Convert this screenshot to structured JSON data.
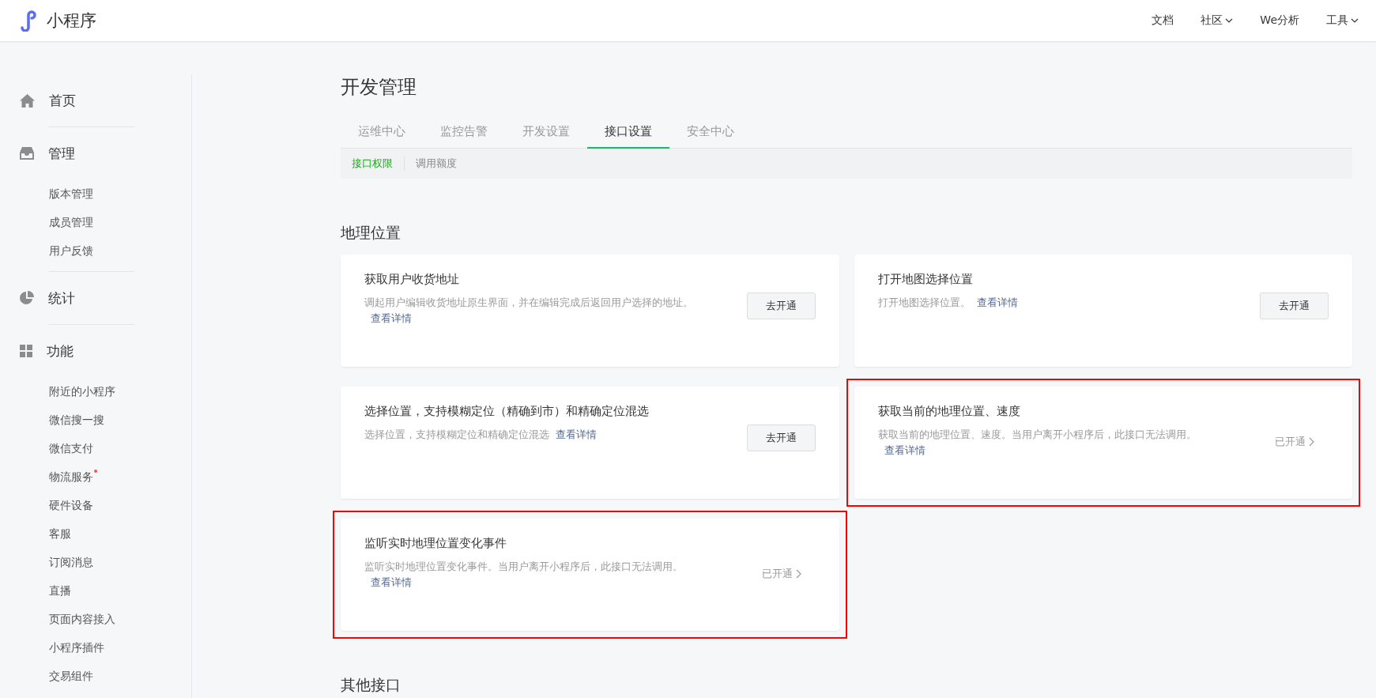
{
  "header": {
    "logo_text": "小程序",
    "nav": [
      {
        "label": "文档",
        "dropdown": false
      },
      {
        "label": "社区",
        "dropdown": true
      },
      {
        "label": "We分析",
        "dropdown": false
      },
      {
        "label": "工具",
        "dropdown": true
      }
    ]
  },
  "sidebar": {
    "groups": [
      {
        "label": "首页"
      },
      {
        "label": "管理",
        "items": [
          {
            "label": "版本管理",
            "badge": false
          },
          {
            "label": "成员管理",
            "badge": false
          },
          {
            "label": "用户反馈",
            "badge": false
          }
        ]
      },
      {
        "label": "统计"
      },
      {
        "label": "功能",
        "items": [
          {
            "label": "附近的小程序",
            "badge": false
          },
          {
            "label": "微信搜一搜",
            "badge": false
          },
          {
            "label": "微信支付",
            "badge": false
          },
          {
            "label": "物流服务",
            "badge": true
          },
          {
            "label": "硬件设备",
            "badge": false
          },
          {
            "label": "客服",
            "badge": false
          },
          {
            "label": "订阅消息",
            "badge": false
          },
          {
            "label": "直播",
            "badge": false
          },
          {
            "label": "页面内容接入",
            "badge": false
          },
          {
            "label": "小程序插件",
            "badge": false
          },
          {
            "label": "交易组件",
            "badge": false
          }
        ]
      }
    ]
  },
  "page": {
    "title": "开发管理",
    "tabs": [
      {
        "label": "运维中心",
        "selected": false
      },
      {
        "label": "监控告警",
        "selected": false
      },
      {
        "label": "开发设置",
        "selected": false
      },
      {
        "label": "接口设置",
        "selected": true
      },
      {
        "label": "安全中心",
        "selected": false
      }
    ],
    "subtabs": [
      {
        "label": "接口权限",
        "selected": true
      },
      {
        "label": "调用额度",
        "selected": false
      }
    ],
    "sections": [
      {
        "title": "地理位置",
        "cards": [
          {
            "title": "获取用户收货地址",
            "description": "调起用户编辑收货地址原生界面，并在编辑完成后返回用户选择的地址。",
            "link": "查看详情",
            "kind": "button",
            "action": "去开通",
            "highlighted": false
          },
          {
            "title": "打开地图选择位置",
            "description": "打开地图选择位置。",
            "link": "查看详情",
            "kind": "button",
            "action": "去开通",
            "highlighted": false
          },
          {
            "title": "选择位置，支持模糊定位（精确到市）和精确定位混选",
            "description": "选择位置，支持模糊定位和精确定位混选",
            "link": "查看详情",
            "kind": "button",
            "action": "去开通",
            "highlighted": false
          },
          {
            "title": "获取当前的地理位置、速度",
            "description": "获取当前的地理位置、速度。当用户离开小程序后，此接口无法调用。",
            "link": "查看详情",
            "kind": "status",
            "action": "已开通",
            "highlighted": true
          },
          {
            "title": "监听实时地理位置变化事件",
            "description": "监听实时地理位置变化事件。当用户离开小程序后，此接口无法调用。",
            "link": "查看详情",
            "kind": "status",
            "action": "已开通",
            "highlighted": true
          }
        ]
      },
      {
        "title": "其他接口"
      }
    ]
  }
}
